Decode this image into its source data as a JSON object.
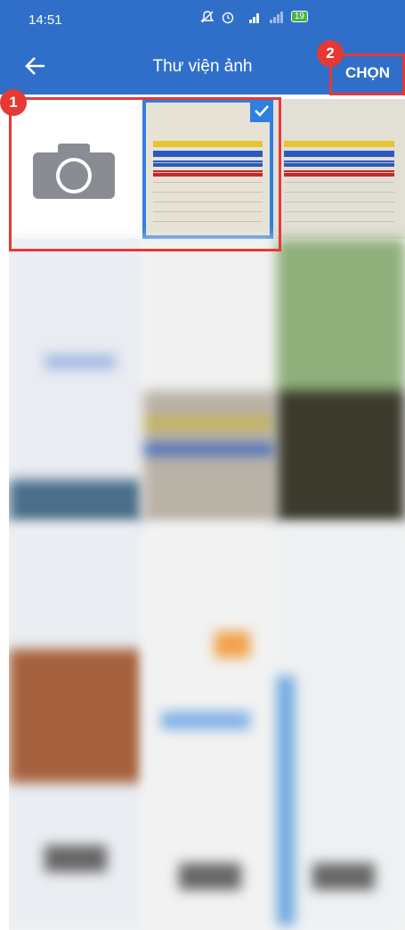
{
  "status": {
    "time": "14:51",
    "icons": [
      "mute-icon",
      "alarm-icon",
      "signal-4g-icon",
      "signal-icon",
      "battery-icon"
    ],
    "battery": "19"
  },
  "app_bar": {
    "back_icon": "arrow-left-icon",
    "title": "Thư viện ảnh",
    "select_label": "CHỌN"
  },
  "markers": {
    "first": "1",
    "second": "2"
  },
  "gallery": {
    "camera_icon": "camera-icon",
    "selected_index": 1
  },
  "colors": {
    "primary": "#2f6fc9",
    "highlight": "#e53935",
    "select": "#2f7fe0"
  }
}
